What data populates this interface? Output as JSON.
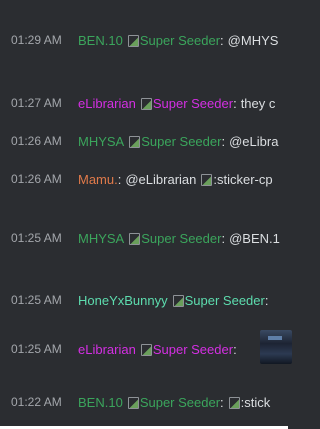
{
  "badge_text": "Super Seeder",
  "messages": [
    {
      "time": "01:29 AM",
      "user": "BEN.10",
      "color": "#3ba55c",
      "badge": "Super Seeder",
      "colon": ":",
      "text": "@MHYS"
    },
    {
      "time": "01:27 AM",
      "user": "eLibrarian",
      "color": "#d42fe3",
      "badge": "Super Seeder",
      "colon": ":",
      "text": "they c"
    },
    {
      "time": "01:26 AM",
      "user": "MHYSA",
      "color": "#3ba55c",
      "badge": "Super Seeder",
      "colon": ":",
      "text": "@eLibra"
    },
    {
      "time": "01:26 AM",
      "user": "Mamu.",
      "color": "#e07a4a",
      "colon": ":",
      "text": "@eLibrarian",
      "sticker": ":sticker-cp"
    },
    {
      "time": "01:25 AM",
      "user": "MHYSA",
      "color": "#3ba55c",
      "badge": "Super Seeder",
      "colon": ":",
      "text": "@BEN.1"
    },
    {
      "time": "01:25 AM",
      "user": "HoneYxBunnyy",
      "color": "#5ddcae",
      "badge": "Super Seeder",
      "colon": ":",
      "text": ""
    },
    {
      "time": "01:25 AM",
      "user": "eLibrarian",
      "color": "#d42fe3",
      "badge": "Super Seeder",
      "colon": ":",
      "text": ""
    },
    {
      "time": "01:22 AM",
      "user": "BEN.10",
      "color": "#3ba55c",
      "badge": "Super Seeder",
      "colon": ":",
      "sticker": ":stick"
    }
  ]
}
